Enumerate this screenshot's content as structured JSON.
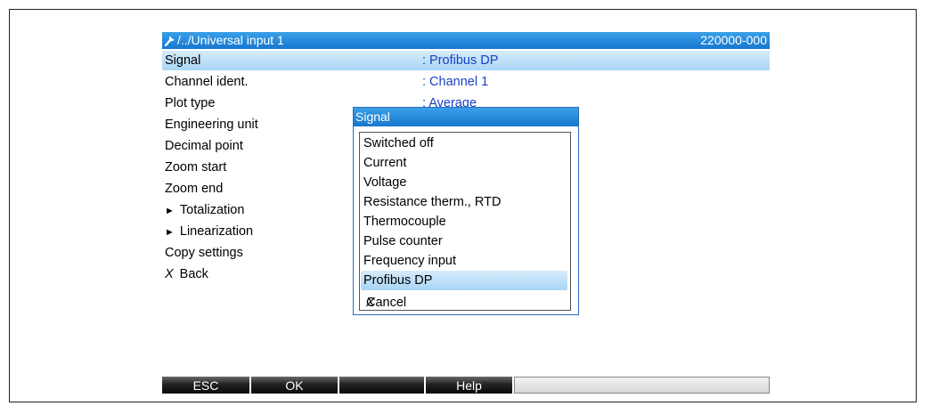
{
  "header": {
    "path": "/../Universal input 1",
    "code": "220000-000"
  },
  "menu": [
    {
      "label": "Signal",
      "value": ": Profibus DP",
      "selected": true
    },
    {
      "label": "Channel ident.",
      "value": ": Channel 1"
    },
    {
      "label": "Plot type",
      "value": ": Average"
    },
    {
      "label": "Engineering unit",
      "value": ""
    },
    {
      "label": "Decimal point",
      "value": ""
    },
    {
      "label": "Zoom start",
      "value": ""
    },
    {
      "label": "Zoom end",
      "value": ""
    },
    {
      "label": "Totalization",
      "value": "",
      "submenu": true
    },
    {
      "label": "Linearization",
      "value": "",
      "submenu": true
    },
    {
      "label": "Copy settings",
      "value": ""
    },
    {
      "label": "Back",
      "value": "",
      "back": true
    }
  ],
  "dialog": {
    "title": "Signal",
    "options": [
      {
        "label": "Switched off"
      },
      {
        "label": "Current"
      },
      {
        "label": "Voltage"
      },
      {
        "label": "Resistance therm., RTD"
      },
      {
        "label": "Thermocouple"
      },
      {
        "label": "Pulse counter"
      },
      {
        "label": "Frequency input"
      },
      {
        "label": "Profibus DP",
        "selected": true
      },
      {
        "label": "Cancel",
        "cancel": true
      }
    ]
  },
  "footer": {
    "esc": "ESC",
    "ok": "OK",
    "blank": "",
    "help": "Help"
  },
  "icons": {
    "header_icon": "wrench-icon",
    "back_icon": "x-mark-icon",
    "submenu_icon": "triangle-right-icon"
  },
  "colors": {
    "header_blue": "#1677cf",
    "value_text": "#1a3fc4",
    "selection": "#a9d5f5"
  }
}
